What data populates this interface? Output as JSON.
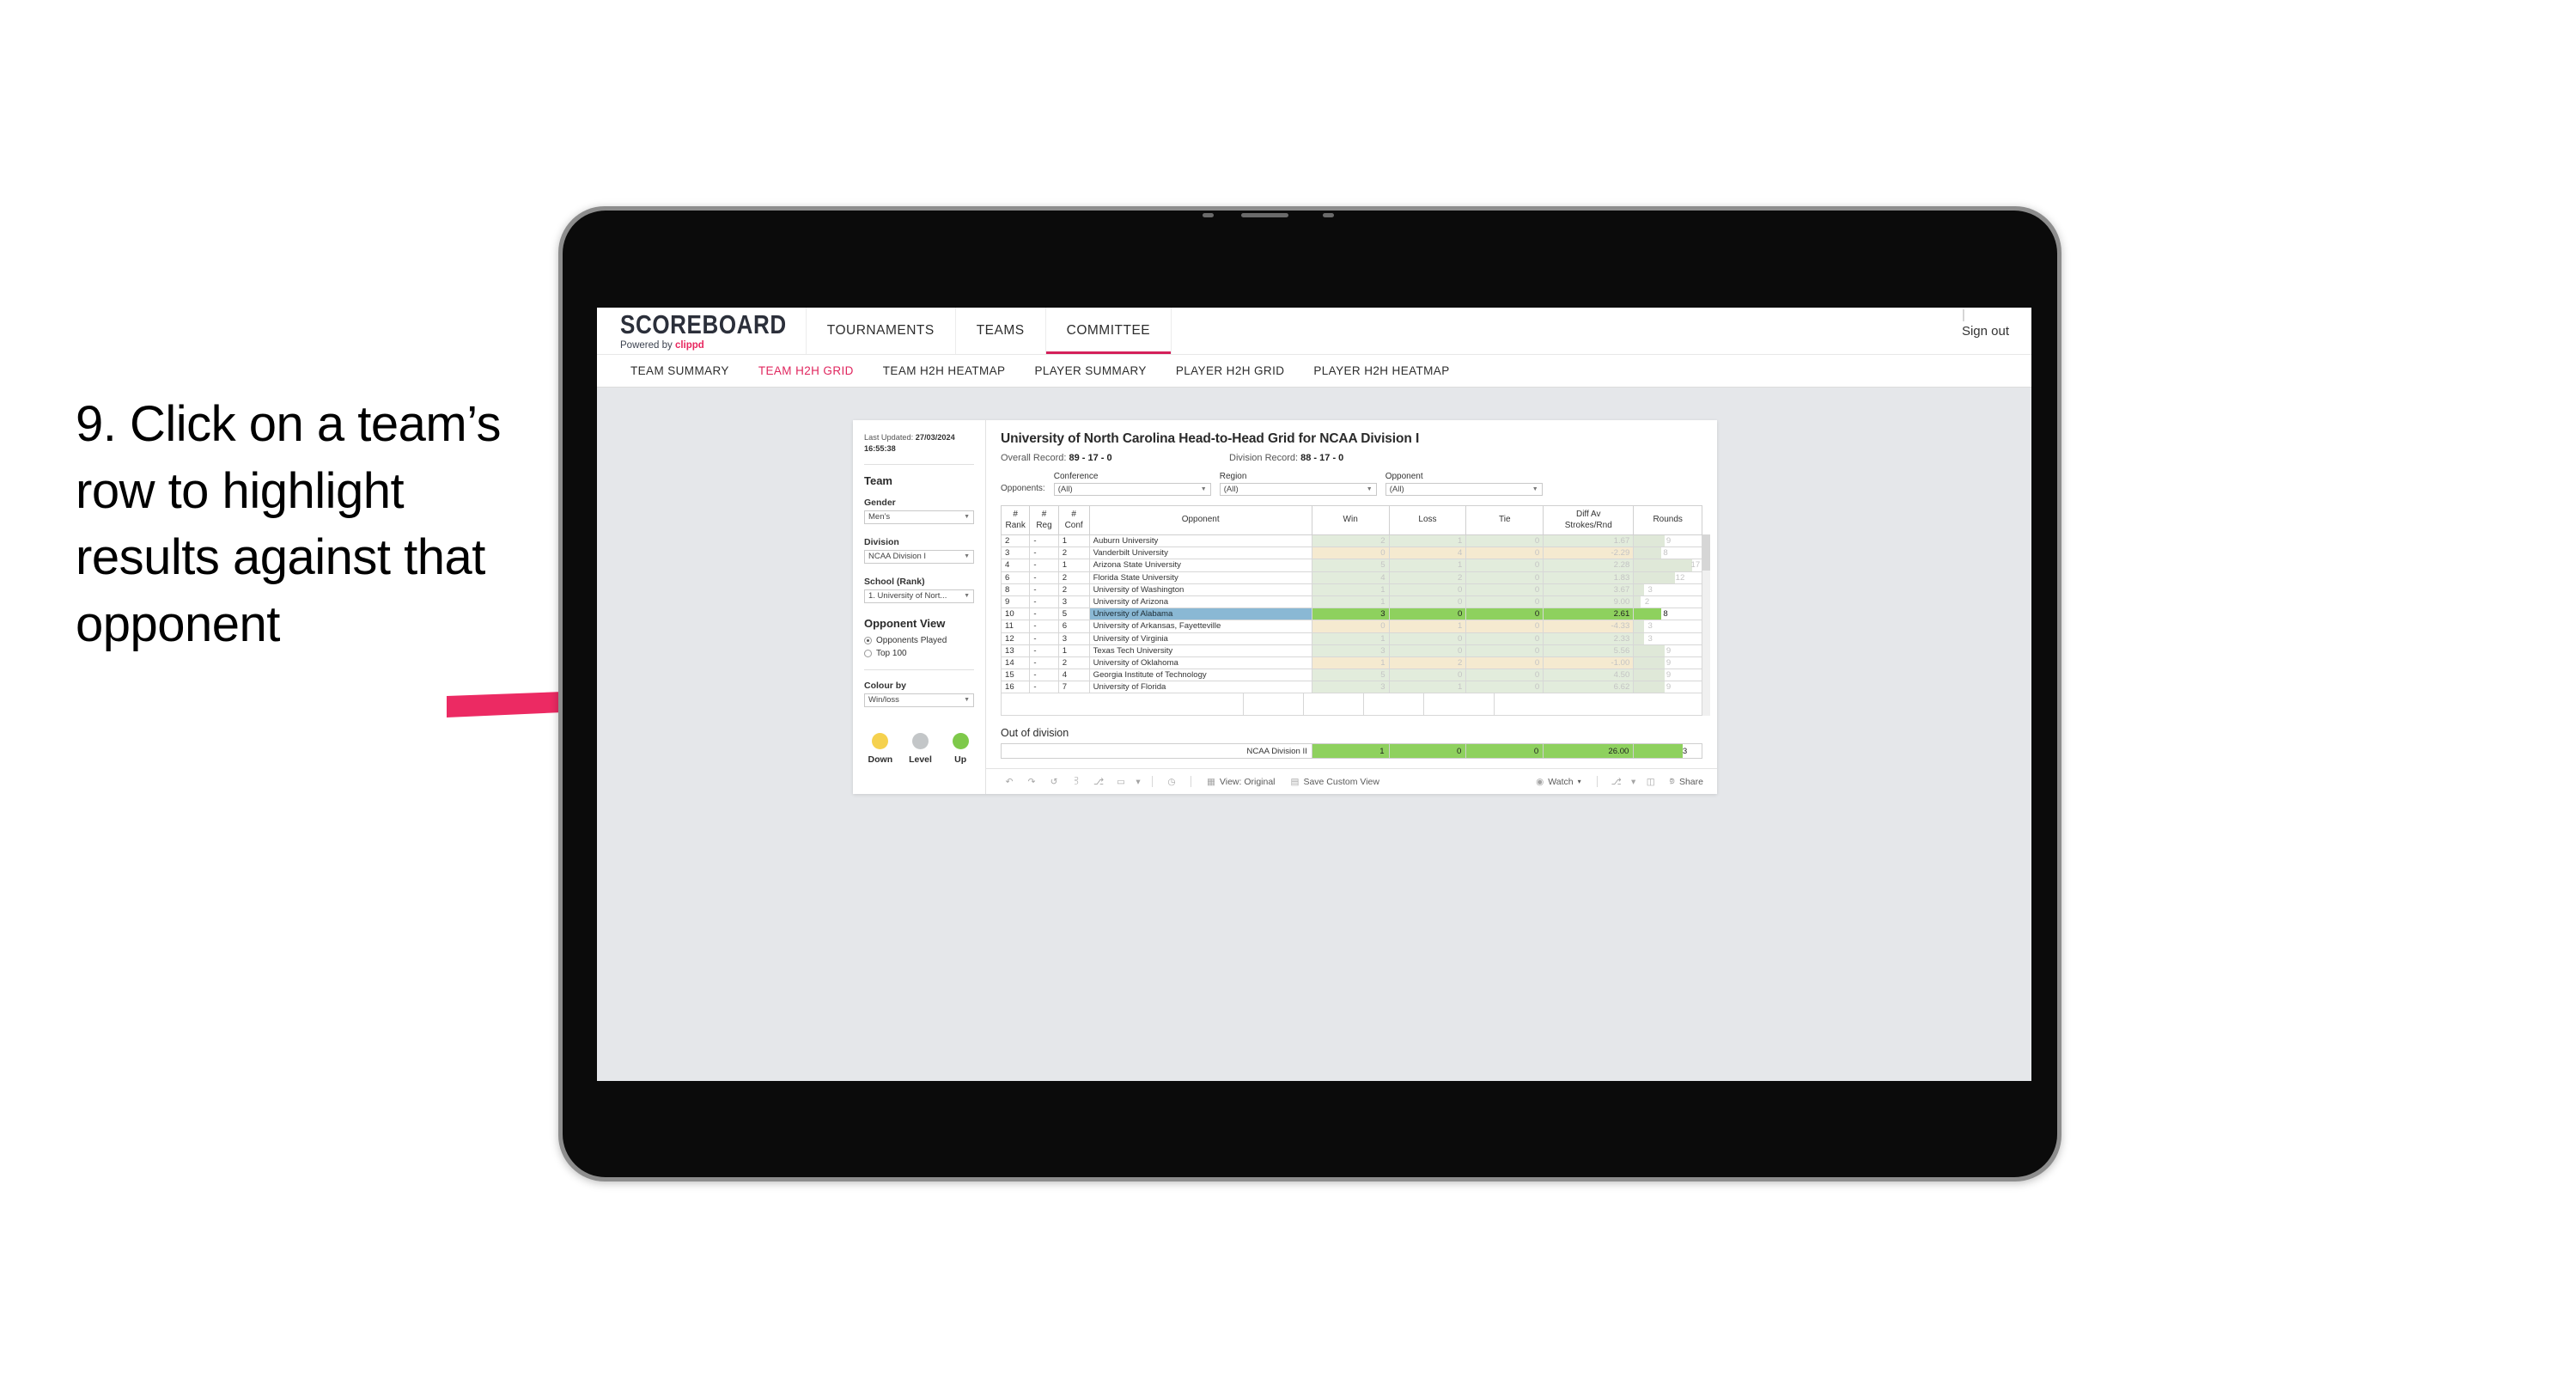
{
  "instruction": {
    "text": "9. Click on a team’s row to highlight results against that opponent",
    "arrow_color": "#ec2a63"
  },
  "app": {
    "logo_main": "SCOREBOARD",
    "logo_sub_prefix": "Powered by ",
    "logo_sub_brand": "clippd",
    "top_nav": [
      {
        "label": "TOURNAMENTS",
        "active": false
      },
      {
        "label": "TEAMS",
        "active": false
      },
      {
        "label": "COMMITTEE",
        "active": true
      }
    ],
    "sign_out": "Sign out",
    "sub_nav": [
      {
        "label": "TEAM SUMMARY",
        "active": false
      },
      {
        "label": "TEAM H2H GRID",
        "active": true
      },
      {
        "label": "TEAM H2H HEATMAP",
        "active": false
      },
      {
        "label": "PLAYER SUMMARY",
        "active": false
      },
      {
        "label": "PLAYER H2H GRID",
        "active": false
      },
      {
        "label": "PLAYER H2H HEATMAP",
        "active": false
      }
    ],
    "accent_color": "#e0265e"
  },
  "filters": {
    "last_updated_label": "Last Updated: ",
    "last_updated_value": "27/03/2024 16:55:38",
    "team_heading": "Team",
    "gender_label": "Gender",
    "gender_value": "Men’s",
    "division_label": "Division",
    "division_value": "NCAA Division I",
    "school_label": "School (Rank)",
    "school_value": "1. University of Nort...",
    "opponent_view_heading": "Opponent View",
    "opponent_view_options": [
      {
        "label": "Opponents Played",
        "selected": true
      },
      {
        "label": "Top 100",
        "selected": false
      }
    ],
    "colour_by_label": "Colour by",
    "colour_by_value": "Win/loss",
    "legend": [
      {
        "label": "Down",
        "color": "#f5d14e"
      },
      {
        "label": "Level",
        "color": "#c3c6c8"
      },
      {
        "label": "Up",
        "color": "#7ec94a"
      }
    ]
  },
  "viz": {
    "title": "University of North Carolina Head-to-Head Grid for NCAA Division I",
    "overall_record_label": "Overall Record: ",
    "overall_record_value": "89 - 17 - 0",
    "division_record_label": "Division Record: ",
    "division_record_value": "88 - 17 - 0",
    "opponents_label": "Opponents:",
    "opponent_filters": [
      {
        "label": "Conference",
        "value": "(All)"
      },
      {
        "label": "Region",
        "value": "(All)"
      },
      {
        "label": "Opponent",
        "value": "(All)"
      }
    ],
    "columns": [
      "# Rank",
      "# Reg",
      "# Conf",
      "Opponent",
      "Win",
      "Loss",
      "Tie",
      "Diff Av Strokes/Rnd",
      "Rounds"
    ],
    "column_lines": [
      [
        "#",
        "Rank"
      ],
      [
        "#",
        "Reg"
      ],
      [
        "#",
        "Conf"
      ],
      [
        "Opponent",
        ""
      ],
      [
        "Win",
        ""
      ],
      [
        "Loss",
        ""
      ],
      [
        "Tie",
        ""
      ],
      [
        "Diff Av",
        "Strokes/Rnd"
      ],
      [
        "Rounds",
        ""
      ]
    ],
    "rows": [
      {
        "rank": "2",
        "reg": "-",
        "conf": "1",
        "opponent": "Auburn University",
        "win": "2",
        "loss": "1",
        "tie": "0",
        "diff": "1.67",
        "rounds": "9",
        "trend": "up",
        "selected": false
      },
      {
        "rank": "3",
        "reg": "-",
        "conf": "2",
        "opponent": "Vanderbilt University",
        "win": "0",
        "loss": "4",
        "tie": "0",
        "diff": "-2.29",
        "rounds": "8",
        "trend": "down",
        "selected": false
      },
      {
        "rank": "4",
        "reg": "-",
        "conf": "1",
        "opponent": "Arizona State University",
        "win": "5",
        "loss": "1",
        "tie": "0",
        "diff": "2.28",
        "rounds": "17",
        "trend": "up",
        "selected": false
      },
      {
        "rank": "6",
        "reg": "-",
        "conf": "2",
        "opponent": "Florida State University",
        "win": "4",
        "loss": "2",
        "tie": "0",
        "diff": "1.83",
        "rounds": "12",
        "trend": "up",
        "selected": false
      },
      {
        "rank": "8",
        "reg": "-",
        "conf": "2",
        "opponent": "University of Washington",
        "win": "1",
        "loss": "0",
        "tie": "0",
        "diff": "3.67",
        "rounds": "3",
        "trend": "up",
        "selected": false
      },
      {
        "rank": "9",
        "reg": "-",
        "conf": "3",
        "opponent": "University of Arizona",
        "win": "1",
        "loss": "0",
        "tie": "0",
        "diff": "9.00",
        "rounds": "2",
        "trend": "up",
        "selected": false
      },
      {
        "rank": "10",
        "reg": "-",
        "conf": "5",
        "opponent": "University of Alabama",
        "win": "3",
        "loss": "0",
        "tie": "0",
        "diff": "2.61",
        "rounds": "8",
        "trend": "up",
        "selected": true
      },
      {
        "rank": "11",
        "reg": "-",
        "conf": "6",
        "opponent": "University of Arkansas, Fayetteville",
        "win": "0",
        "loss": "1",
        "tie": "0",
        "diff": "-4.33",
        "rounds": "3",
        "trend": "down",
        "selected": false
      },
      {
        "rank": "12",
        "reg": "-",
        "conf": "3",
        "opponent": "University of Virginia",
        "win": "1",
        "loss": "0",
        "tie": "0",
        "diff": "2.33",
        "rounds": "3",
        "trend": "up",
        "selected": false
      },
      {
        "rank": "13",
        "reg": "-",
        "conf": "1",
        "opponent": "Texas Tech University",
        "win": "3",
        "loss": "0",
        "tie": "0",
        "diff": "5.56",
        "rounds": "9",
        "trend": "up",
        "selected": false
      },
      {
        "rank": "14",
        "reg": "-",
        "conf": "2",
        "opponent": "University of Oklahoma",
        "win": "1",
        "loss": "2",
        "tie": "0",
        "diff": "-1.00",
        "rounds": "9",
        "trend": "down",
        "selected": false
      },
      {
        "rank": "15",
        "reg": "-",
        "conf": "4",
        "opponent": "Georgia Institute of Technology",
        "win": "5",
        "loss": "0",
        "tie": "0",
        "diff": "4.50",
        "rounds": "9",
        "trend": "up",
        "selected": false
      },
      {
        "rank": "16",
        "reg": "-",
        "conf": "7",
        "opponent": "University of Florida",
        "win": "3",
        "loss": "1",
        "tie": "0",
        "diff": "6.62",
        "rounds": "9",
        "trend": "up",
        "selected": false
      }
    ],
    "out_of_division_title": "Out of division",
    "out_of_division_row": {
      "label": "NCAA Division II",
      "win": "1",
      "loss": "0",
      "tie": "0",
      "diff": "26.00",
      "rounds": "3"
    },
    "colors": {
      "selected_row": "#8ab8d4",
      "bar_green": "#8ed15e",
      "tint_green": "#e2ecdc",
      "tint_yellow": "#f5ead0",
      "rounds_bar": "#dfe8d8"
    }
  },
  "toolbar": {
    "items": [
      {
        "name": "undo-icon",
        "glyph": "↶"
      },
      {
        "name": "redo-icon",
        "glyph": "↷"
      },
      {
        "name": "revert-icon",
        "glyph": "↺"
      },
      {
        "name": "refresh-data-icon",
        "glyph": "⧖"
      },
      {
        "name": "pause-updates-icon",
        "glyph": "⏸"
      },
      {
        "name": "device-layout-icon",
        "glyph": "▭"
      },
      {
        "name": "layout-dropdown-caret",
        "glyph": "▾"
      },
      {
        "name": "clock-icon",
        "glyph": "◷"
      }
    ],
    "view_original_label": "View: Original",
    "save_custom_view_label": "Save Custom View",
    "watch_label": "Watch",
    "share_label": "Share"
  }
}
